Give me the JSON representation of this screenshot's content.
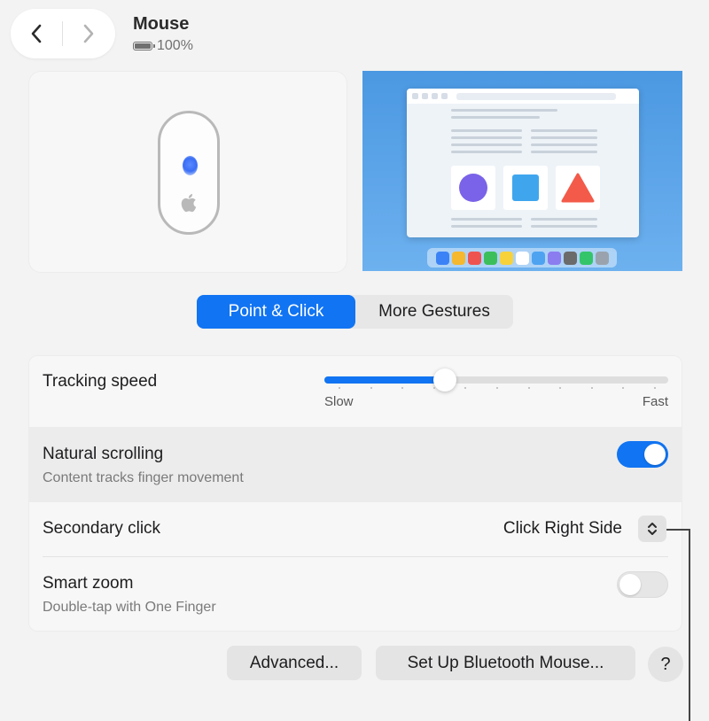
{
  "header": {
    "title": "Mouse",
    "battery_level": "100%",
    "back_icon": "chevron-left-icon",
    "forward_icon": "chevron-right-icon"
  },
  "tabs": [
    {
      "label": "Point & Click",
      "selected": true
    },
    {
      "label": "More Gestures",
      "selected": false
    }
  ],
  "settings": {
    "tracking_speed": {
      "label": "Tracking speed",
      "min_label": "Slow",
      "max_label": "Fast",
      "value_fraction": 0.35
    },
    "natural_scrolling": {
      "label": "Natural scrolling",
      "description": "Content tracks finger movement",
      "enabled": true
    },
    "secondary_click": {
      "label": "Secondary click",
      "value": "Click Right Side"
    },
    "smart_zoom": {
      "label": "Smart zoom",
      "description": "Double-tap with One Finger",
      "enabled": false
    }
  },
  "buttons": {
    "advanced": "Advanced...",
    "setup_bluetooth": "Set Up Bluetooth Mouse...",
    "help": "?"
  },
  "colors": {
    "accent": "#1174f2",
    "window_background": "#f3f3f3",
    "preview_circle": "#7a63e8",
    "preview_square": "#3fa6ee",
    "preview_triangle": "#f35a49"
  }
}
